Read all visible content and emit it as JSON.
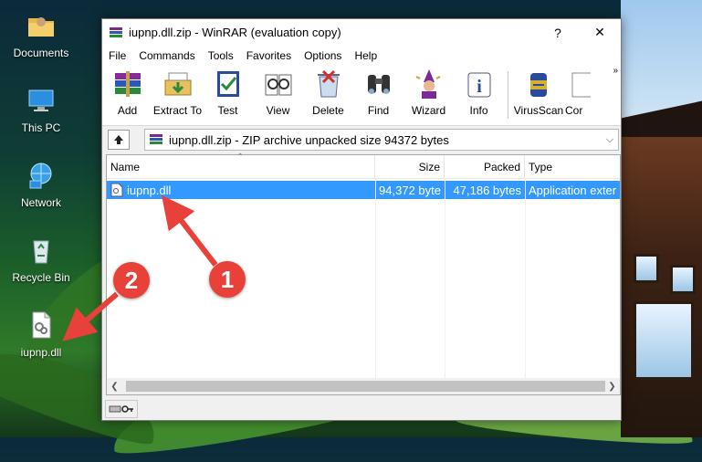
{
  "desktop": {
    "icons": [
      {
        "label": "Documents",
        "icon": "folder-icon"
      },
      {
        "label": "This PC",
        "icon": "computer-icon"
      },
      {
        "label": "Network",
        "icon": "network-icon"
      },
      {
        "label": "Recycle Bin",
        "icon": "recycle-bin-icon"
      },
      {
        "label": "iupnp.dll",
        "icon": "dll-file-icon"
      }
    ]
  },
  "window": {
    "title": "iupnp.dll.zip - WinRAR (evaluation copy)",
    "help_button": "?",
    "close_button": "✕"
  },
  "menu": [
    "File",
    "Commands",
    "Tools",
    "Favorites",
    "Options",
    "Help"
  ],
  "toolbar": {
    "buttons": [
      {
        "label": "Add",
        "icon": "add-archive-icon"
      },
      {
        "label": "Extract To",
        "icon": "extract-icon"
      },
      {
        "label": "Test",
        "icon": "test-icon"
      },
      {
        "label": "View",
        "icon": "view-icon"
      },
      {
        "label": "Delete",
        "icon": "delete-icon"
      },
      {
        "label": "Find",
        "icon": "find-icon"
      },
      {
        "label": "Wizard",
        "icon": "wizard-icon"
      },
      {
        "label": "Info",
        "icon": "info-icon"
      },
      {
        "label": "VirusScan",
        "icon": "virusscan-icon"
      },
      {
        "label": "Cor",
        "icon": "comment-icon"
      }
    ],
    "more": "»"
  },
  "address": {
    "text": "iupnp.dll.zip - ZIP archive unpacked size 94372 bytes"
  },
  "columns": {
    "name": "Name",
    "size": "Size",
    "packed": "Packed",
    "type": "Type"
  },
  "files": [
    {
      "name": "iupnp.dll",
      "size": "94,372 byte",
      "packed": "47,186 bytes",
      "type": "Application exter"
    }
  ],
  "annotations": {
    "step1": "1",
    "step2": "2"
  },
  "colors": {
    "selection": "#3399ff",
    "badge": "#e8413a"
  }
}
